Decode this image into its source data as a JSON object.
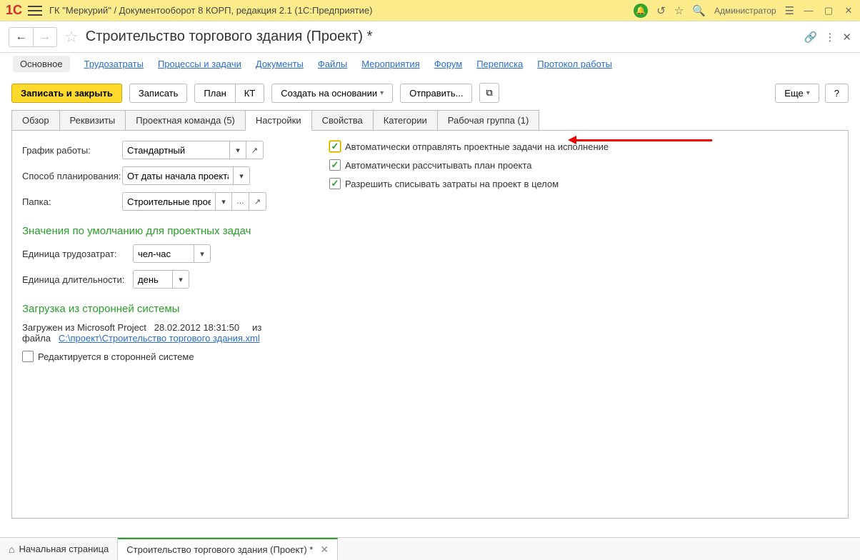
{
  "titlebar": {
    "title": "ГК \"Меркурий\" / Документооборот 8 КОРП, редакция 2.1  (1С:Предприятие)",
    "admin": "Администратор"
  },
  "header": {
    "title": "Строительство торгового здания (Проект) *"
  },
  "nav_tabs": {
    "main": "Основное",
    "labor": "Трудозатраты",
    "processes": "Процессы и задачи",
    "documents": "Документы",
    "files": "Файлы",
    "events": "Мероприятия",
    "forum": "Форум",
    "correspondence": "Переписка",
    "protocol": "Протокол работы"
  },
  "toolbar": {
    "save_close": "Записать и закрыть",
    "save": "Записать",
    "plan": "План",
    "kt": "КТ",
    "create_based": "Создать на основании",
    "send": "Отправить...",
    "more": "Еще",
    "help": "?"
  },
  "inner_tabs": {
    "overview": "Обзор",
    "details": "Реквизиты",
    "team": "Проектная команда (5)",
    "settings": "Настройки",
    "properties": "Свойства",
    "categories": "Категории",
    "workgroup": "Рабочая группа (1)"
  },
  "settings": {
    "schedule_label": "График работы:",
    "schedule_value": "Стандартный",
    "plan_method_label": "Способ планирования:",
    "plan_method_value": "От даты начала проекта",
    "folder_label": "Папка:",
    "folder_value": "Строительные проекть",
    "check_auto_send": "Автоматически отправлять проектные задачи на исполнение",
    "check_auto_calc": "Автоматически рассчитывать план проекта",
    "check_allow_write": "Разрешить списывать затраты на проект в целом",
    "section_defaults": "Значения по умолчанию для проектных задач",
    "labor_unit_label": "Единица трудозатрат:",
    "labor_unit_value": "чел-час",
    "duration_unit_label": "Единица длительности:",
    "duration_unit_value": "день",
    "section_import": "Загрузка из сторонней системы",
    "import_source": "Загружен из Microsoft Project",
    "import_date": "28.02.2012 18:31:50",
    "import_file_label": "из файла",
    "import_file_path": "C:\\проект\\Строительство торгового здания.xml",
    "check_external_edit": "Редактируется в сторонней системе"
  },
  "bottom": {
    "home": "Начальная страница",
    "doc": "Строительство торгового здания (Проект) *"
  }
}
